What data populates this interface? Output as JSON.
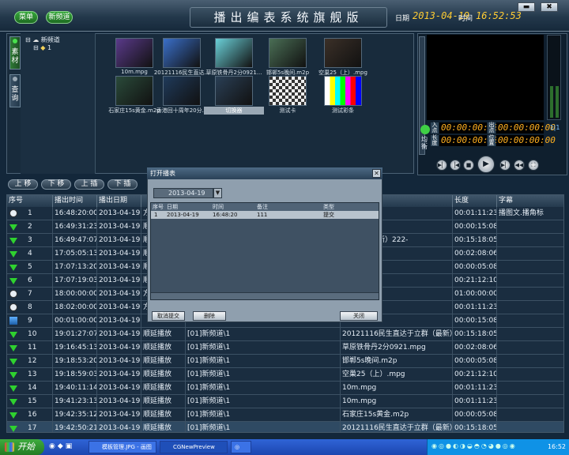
{
  "topbar": {
    "menu_label": "菜单",
    "new_channel_label": "新频道",
    "title": "播出编表系统旗舰版",
    "date_label": "日期",
    "date_value": "2013-04-19",
    "time_label": "时间",
    "time_value": "16:52:53",
    "minimize": "▬",
    "close": "✖"
  },
  "side_tabs": {
    "material": "素材",
    "query": "查询"
  },
  "tree": {
    "root": "新频道",
    "child": "1"
  },
  "library": [
    {
      "label": "10m.mpg",
      "color": "#5a3a8a"
    },
    {
      "label": "20121116民生直达...",
      "color": "#3a6fc9"
    },
    {
      "label": "草原铁骨丹2分0921...",
      "color": "#6ad0d8"
    },
    {
      "label": "邯郸5s晚间.m2p",
      "color": "#4a6e55"
    },
    {
      "label": "空巢25（上）.mpg",
      "color": "#3b3028"
    },
    {
      "label": "石家庄15s黄金.m2p",
      "color": "#2a4a3a"
    },
    {
      "label": "香港回十周年20分...",
      "color": "#1f3a5a"
    },
    {
      "label": "切换器",
      "color": "#2a3f55"
    },
    {
      "label": "测试卡",
      "color": "#c0c0c0"
    },
    {
      "label": "测试彩条",
      "color": "#ffffff"
    }
  ],
  "monitor": {
    "in_label": "入点",
    "out_label": "出点",
    "len_label": "长度",
    "pos_label": "位置",
    "tc1": "00:00:00:00",
    "tc2": "00:00:00:00",
    "tc3": "00:00:00:00",
    "tc4": "00:00:00:00",
    "balance": "均衡"
  },
  "toolbar": {
    "up": "上 移",
    "down": "下 移",
    "insert_up": "上 插",
    "insert_down": "下 插"
  },
  "grid": {
    "headers": {
      "seq": "序号",
      "time": "播出时间",
      "date": "播出日期",
      "length": "长度",
      "subtitle": "字幕"
    },
    "rows": [
      {
        "seq": "1",
        "time": "16:48:20:00",
        "date": "2013-04-19",
        "type": "方",
        "src": "",
        "name": "",
        "len": "00:01:11:23",
        "sub": "播图文.播角标",
        "icon": "clock"
      },
      {
        "seq": "2",
        "time": "16:49:31:23",
        "date": "2013-04-19",
        "type": "顺",
        "src": "",
        "name": "",
        "len": "00:00:15:08",
        "sub": "",
        "icon": "arrow"
      },
      {
        "seq": "3",
        "time": "16:49:47:07",
        "date": "2013-04-19",
        "type": "顺",
        "src": "",
        "name": "于立群（最新）222-",
        "len": "00:15:18:05",
        "sub": "",
        "icon": "arrow"
      },
      {
        "seq": "4",
        "time": "17:05:05:13",
        "date": "2013-04-19",
        "type": "顺",
        "src": "",
        "name": "mpg",
        "len": "00:02:08:06",
        "sub": "",
        "icon": "arrow"
      },
      {
        "seq": "5",
        "time": "17:07:13:20",
        "date": "2013-04-19",
        "type": "顺",
        "src": "",
        "name": "",
        "len": "00:00:05:08",
        "sub": "",
        "icon": "arrow"
      },
      {
        "seq": "6",
        "time": "17:07:19:03",
        "date": "2013-04-19",
        "type": "顺",
        "src": "",
        "name": "",
        "len": "00:21:12:10",
        "sub": "",
        "icon": "arrow"
      },
      {
        "seq": "7",
        "time": "18:00:00:00",
        "date": "2013-04-19",
        "type": "方",
        "src": "",
        "name": "",
        "len": "01:00:00:00",
        "sub": "",
        "icon": "clock"
      },
      {
        "seq": "8",
        "time": "18:02:00:00",
        "date": "2013-04-19",
        "type": "方",
        "src": "",
        "name": "",
        "len": "00:01:11:23",
        "sub": "",
        "icon": "clock"
      },
      {
        "seq": "9",
        "time": "00:01:00:00",
        "date": "2013-04-19",
        "type": "",
        "src": "",
        "name": "",
        "len": "00:00:15:08",
        "sub": "",
        "icon": "box"
      },
      {
        "seq": "10",
        "time": "19:01:27:07",
        "date": "2013-04-19",
        "type": "顺延播放",
        "src": "[01]新频道\\1",
        "name": "20121116民生直达于立群（最新）222-",
        "len": "00:15:18:05",
        "sub": "",
        "icon": "arrow"
      },
      {
        "seq": "11",
        "time": "19:16:45:13",
        "date": "2013-04-19",
        "type": "顺延播放",
        "src": "[01]新频道\\1",
        "name": "草原铁骨丹2分0921.mpg",
        "len": "00:02:08:06",
        "sub": "",
        "icon": "arrow"
      },
      {
        "seq": "12",
        "time": "19:18:53:20",
        "date": "2013-04-19",
        "type": "顺延播放",
        "src": "[01]新频道\\1",
        "name": "邯郸5s晚间.m2p",
        "len": "00:00:05:08",
        "sub": "",
        "icon": "arrow"
      },
      {
        "seq": "13",
        "time": "19:18:59:03",
        "date": "2013-04-19",
        "type": "顺延播放",
        "src": "[01]新频道\\1",
        "name": "空巢25（上）.mpg",
        "len": "00:21:12:10",
        "sub": "",
        "icon": "arrow"
      },
      {
        "seq": "14",
        "time": "19:40:11:14",
        "date": "2013-04-19",
        "type": "顺延播放",
        "src": "[01]新频道\\1",
        "name": "10m.mpg",
        "len": "00:01:11:23",
        "sub": "",
        "icon": "arrow"
      },
      {
        "seq": "15",
        "time": "19:41:23:13",
        "date": "2013-04-19",
        "type": "顺延播放",
        "src": "[01]新频道\\1",
        "name": "10m.mpg",
        "len": "00:01:11:23",
        "sub": "",
        "icon": "arrow"
      },
      {
        "seq": "16",
        "time": "19:42:35:12",
        "date": "2013-04-19",
        "type": "顺延播放",
        "src": "[01]新频道\\1",
        "name": "石家庄15s黄金.m2p",
        "len": "00:00:05:08",
        "sub": "",
        "icon": "arrow"
      },
      {
        "seq": "17",
        "time": "19:42:50:21",
        "date": "2013-04-19",
        "type": "顺延播放",
        "src": "[01]新频道\\1",
        "name": "20121116民生直达于立群（最新）222-",
        "len": "00:15:18:05",
        "sub": "",
        "icon": "arrow"
      }
    ]
  },
  "dialog": {
    "title": "打开播表",
    "date_value": "2013-04-19",
    "headers": {
      "seq": "序号",
      "date": "日期",
      "time": "时间",
      "note": "备注",
      "type": "类型"
    },
    "row": {
      "seq": "1",
      "date": "2013-04-19",
      "time": "16:48:20",
      "note": "111",
      "type": "提交"
    },
    "cancel_submit": "取消提交",
    "delete": "删除",
    "close": "关闭"
  },
  "taskbar": {
    "start": "开始",
    "task1": "模板管理.JPG - 画图",
    "task2": "CGNewPreview",
    "clock": "16:52"
  }
}
